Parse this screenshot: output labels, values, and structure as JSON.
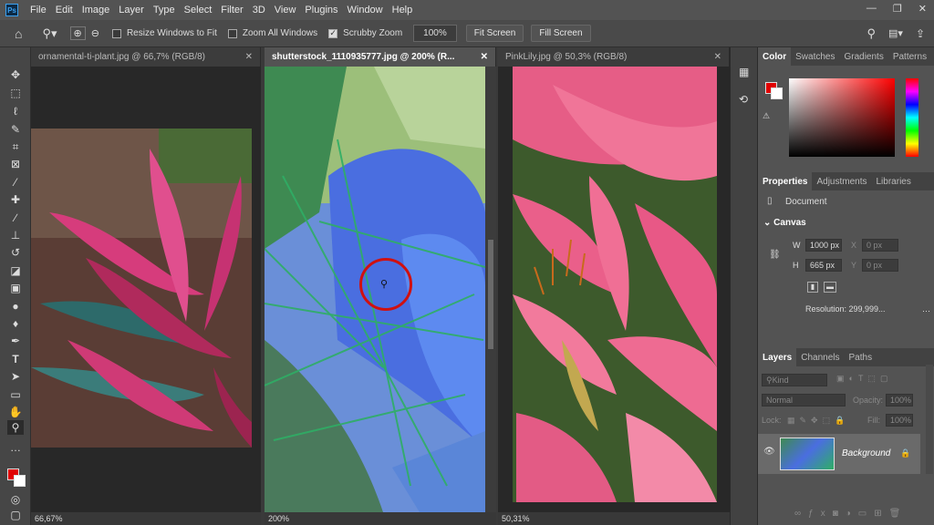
{
  "menu": [
    "File",
    "Edit",
    "Image",
    "Layer",
    "Type",
    "Select",
    "Filter",
    "3D",
    "View",
    "Plugins",
    "Window",
    "Help"
  ],
  "app_logo": "Ps",
  "options": {
    "resize_windows": "Resize Windows to Fit",
    "zoom_all": "Zoom All Windows",
    "scrubby_zoom": "Scrubby Zoom",
    "zoom_percent": "100%",
    "fit_screen": "Fit Screen",
    "fill_screen": "Fill Screen"
  },
  "documents": [
    {
      "tab": "ornamental-ti-plant.jpg @ 66,7% (RGB/8)",
      "status": "66,67%"
    },
    {
      "tab": "shutterstock_1110935777.jpg @ 200% (R...",
      "status": "200%"
    },
    {
      "tab": "PinkLily.jpg @ 50,3% (RGB/8)",
      "status": "50,31%"
    }
  ],
  "color_panel": {
    "tabs": [
      "Color",
      "Swatches",
      "Gradients",
      "Patterns"
    ],
    "foreground": "#e00000"
  },
  "properties_panel": {
    "tabs": [
      "Properties",
      "Adjustments",
      "Libraries"
    ],
    "doc_label": "Document",
    "section": "Canvas",
    "w_label": "W",
    "w_value": "1000 px",
    "h_label": "H",
    "h_value": "665 px",
    "x_label": "X",
    "x_value": "0 px",
    "y_label": "Y",
    "y_value": "0 px",
    "resolution": "Resolution: 299,999..."
  },
  "layers_panel": {
    "tabs": [
      "Layers",
      "Channels",
      "Paths"
    ],
    "kind": "Kind",
    "blend": "Normal",
    "opacity_label": "Opacity:",
    "opacity": "100%",
    "lock_label": "Lock:",
    "fill_label": "Fill:",
    "fill": "100%",
    "layer_name": "Background"
  }
}
